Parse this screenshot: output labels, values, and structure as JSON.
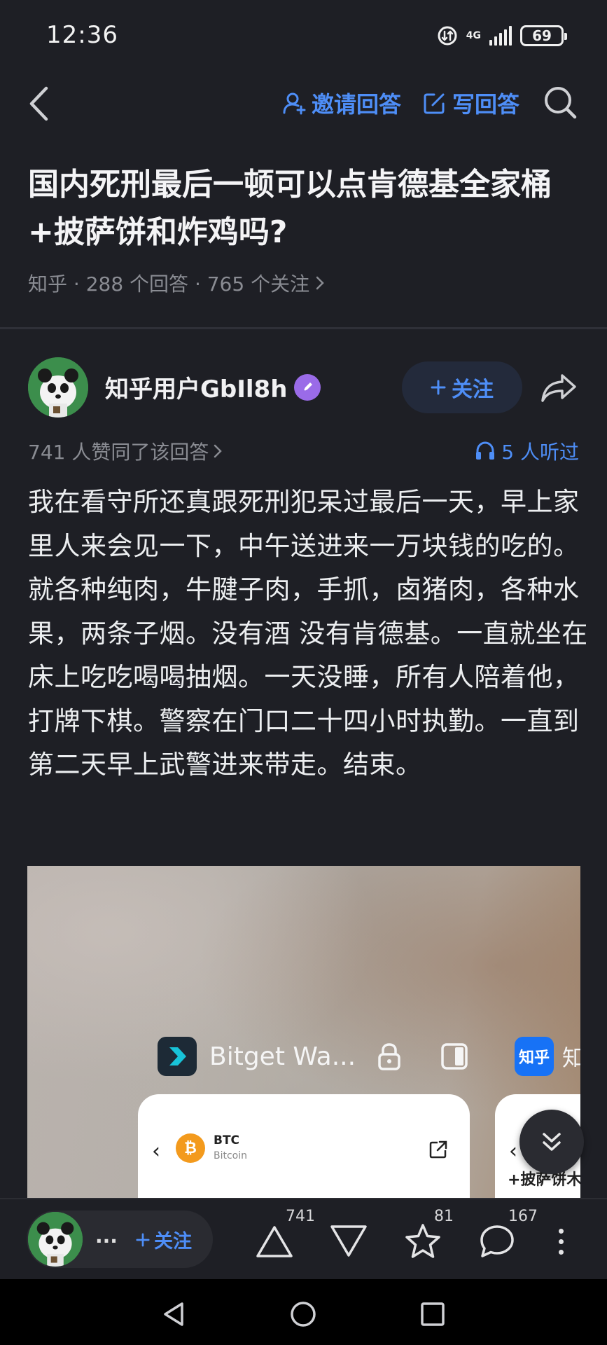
{
  "status_bar": {
    "time": "12:36",
    "network": "4G",
    "battery": "69"
  },
  "nav": {
    "invite_label": "邀请回答",
    "write_label": "写回答"
  },
  "question": {
    "title": "国内死刑最后一顿可以点肯德基全家桶+披萨饼和炸鸡吗?",
    "meta": "知乎 · 288 个回答 · 765 个关注"
  },
  "answer": {
    "author_name": "知乎用户GbIl8h",
    "follow_label": "关注",
    "vote_text": "741 人赞同了该回答",
    "listen_text": "5 人听过",
    "body": "我在看守所还真跟死刑犯呆过最后一天，早上家里人来会见一下，中午送进来一万块钱的吃的。就各种纯肉，牛腱子肉，手抓，卤猪肉，各种水果，两条子烟。没有酒 没有肯德基。一直就坐在床上吃吃喝喝抽烟。一天没睡，所有人陪着他，打牌下棋。警察在门口二十四小时执勤。一直到第二天早上武警进来带走。结束。"
  },
  "embedded_image": {
    "app1_title": "Bitget Wa...",
    "coin_symbol": "BTC",
    "coin_name": "Bitcoin",
    "app2_icon": "知乎",
    "app2_title": "知",
    "card2_text": "+披萨饼木"
  },
  "bottom_toolbar": {
    "mini_name": "...",
    "follow_label": "关注",
    "upvote_count": "741",
    "favorite_count": "81",
    "comment_count": "167"
  },
  "colors": {
    "background": "#1e1f25",
    "accent": "#4e8ef7",
    "muted_text": "#8a8c93"
  }
}
